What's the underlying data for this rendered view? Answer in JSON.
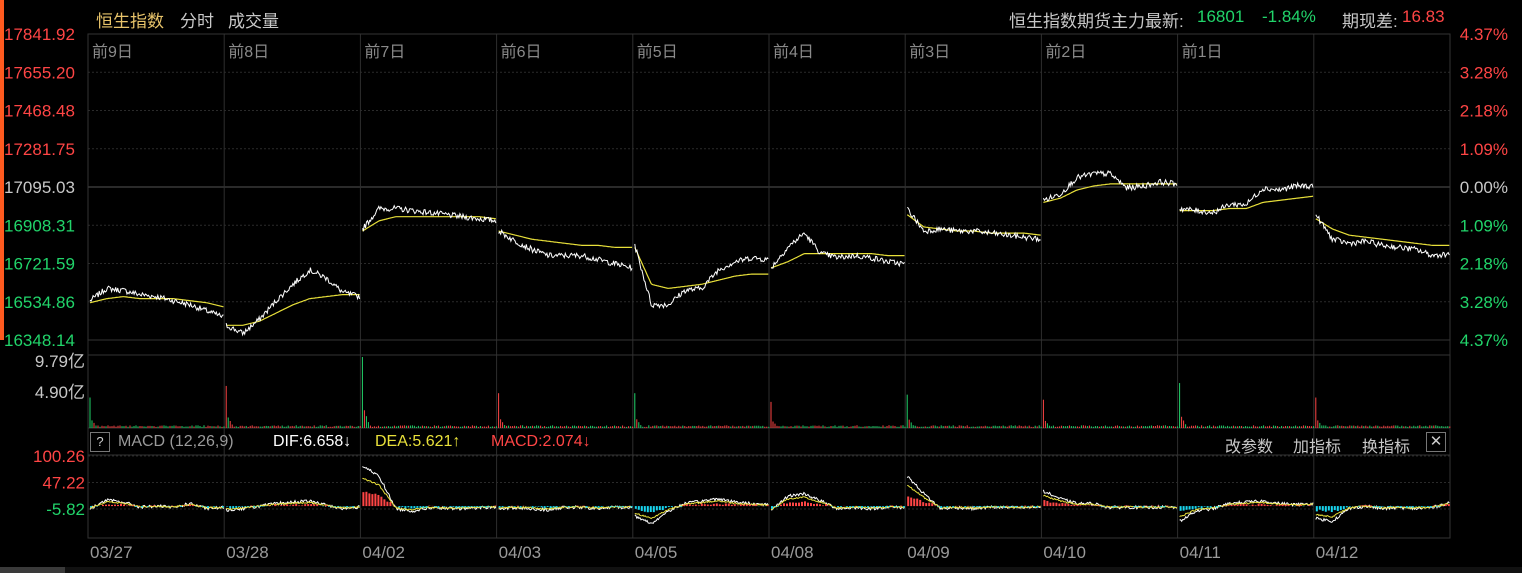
{
  "header": {
    "index_name": "恒生指数",
    "tab_intraday": "分时",
    "tab_volume": "成交量",
    "futures_label": "恒生指数期货主力最新:",
    "futures_price": "16801",
    "futures_change": "-1.84%",
    "basis_label": "期现差:",
    "basis_value": "16.83"
  },
  "macd_panel": {
    "help": "?",
    "title": "MACD (12,26,9)",
    "dif": "DIF:6.658↓",
    "dea": "DEA:5.621↑",
    "macd": "MACD:2.074↓",
    "btn_params": "改参数",
    "btn_add": "加指标",
    "btn_switch": "换指标",
    "close": "✕"
  },
  "colors": {
    "background": "#000000",
    "grid": "#2a2a2a",
    "up": "#ff4545",
    "down": "#21d46a",
    "price_line": "#ffffff",
    "avg_line": "#e8e03a",
    "dea_line": "#e8e03a",
    "macd_down_bar": "#18d6f0",
    "gold_text": "#e7c36a"
  },
  "chart_data": {
    "type": "line",
    "title": "恒生指数",
    "prev_close": 17095.03,
    "price_ticks": [
      "17841.92",
      "17655.20",
      "17468.48",
      "17281.75",
      "17095.03",
      "16908.31",
      "16721.59",
      "16534.86",
      "16348.14"
    ],
    "pct_ticks": [
      "4.37%",
      "3.28%",
      "2.18%",
      "1.09%",
      "0.00%",
      "1.09%",
      "2.18%",
      "3.28%",
      "4.37%"
    ],
    "ylim": [
      16348.14,
      17841.92
    ],
    "day_labels": [
      "前9日",
      "前8日",
      "前7日",
      "前6日",
      "前5日",
      "前4日",
      "前3日",
      "前2日",
      "前1日",
      ""
    ],
    "dates": [
      "03/27",
      "03/28",
      "04/02",
      "04/03",
      "04/05",
      "04/08",
      "04/09",
      "04/10",
      "04/11",
      "04/12"
    ],
    "volume_ticks": [
      "9.79亿",
      "4.90亿"
    ],
    "volume_max": 9.79,
    "macd_ticks": [
      "100.26",
      "47.22",
      "-5.82"
    ],
    "series": [
      {
        "name": "price",
        "days": [
          [
            16540,
            16600,
            16590,
            16570,
            16560,
            16540,
            16520,
            16490,
            16460
          ],
          [
            16420,
            16380,
            16450,
            16540,
            16620,
            16690,
            16650,
            16580,
            16560
          ],
          [
            16890,
            16990,
            16990,
            16980,
            16970,
            16960,
            16950,
            16940,
            16930
          ],
          [
            16880,
            16830,
            16790,
            16760,
            16760,
            16760,
            16740,
            16720,
            16700
          ],
          [
            16810,
            16520,
            16520,
            16590,
            16600,
            16690,
            16730,
            16750,
            16740
          ],
          [
            16700,
            16800,
            16870,
            16770,
            16750,
            16760,
            16750,
            16730,
            16720
          ],
          [
            16990,
            16880,
            16890,
            16880,
            16880,
            16870,
            16860,
            16850,
            16840
          ],
          [
            17030,
            17060,
            17140,
            17160,
            17160,
            17090,
            17100,
            17120,
            17110
          ],
          [
            16990,
            16980,
            16970,
            17010,
            17010,
            17090,
            17080,
            17100,
            17100
          ],
          [
            16960,
            16840,
            16820,
            16830,
            16810,
            16800,
            16790,
            16760,
            16770
          ]
        ]
      },
      {
        "name": "average",
        "days": [
          [
            16530,
            16550,
            16560,
            16550,
            16550,
            16550,
            16540,
            16530,
            16510
          ],
          [
            16420,
            16420,
            16440,
            16480,
            16520,
            16550,
            16560,
            16570,
            16570
          ],
          [
            16880,
            16930,
            16950,
            16950,
            16950,
            16950,
            16950,
            16950,
            16940
          ],
          [
            16880,
            16860,
            16840,
            16830,
            16820,
            16810,
            16810,
            16800,
            16800
          ],
          [
            16800,
            16620,
            16600,
            16610,
            16620,
            16640,
            16660,
            16670,
            16670
          ],
          [
            16700,
            16730,
            16770,
            16770,
            16770,
            16770,
            16770,
            16760,
            16760
          ],
          [
            16960,
            16900,
            16890,
            16880,
            16880,
            16870,
            16870,
            16870,
            16860
          ],
          [
            17020,
            17040,
            17080,
            17100,
            17110,
            17110,
            17110,
            17110,
            17110
          ],
          [
            16980,
            16980,
            16980,
            16990,
            16990,
            17020,
            17030,
            17040,
            17050
          ],
          [
            16940,
            16890,
            16860,
            16850,
            16840,
            16830,
            16820,
            16810,
            16810
          ]
        ]
      },
      {
        "name": "volume",
        "spikes": [
          4.2,
          5.8,
          9.79,
          4.8,
          4.8,
          3.6,
          4.6,
          3.9,
          6.2,
          4.2
        ]
      },
      {
        "name": "dif",
        "days": [
          [
            -5,
            12,
            8,
            -2,
            0,
            -3,
            5,
            -5,
            -3
          ],
          [
            -8,
            -5,
            0,
            5,
            8,
            10,
            2,
            -5,
            -2
          ],
          [
            80,
            60,
            -5,
            -10,
            -3,
            -5,
            -5,
            -3,
            -2
          ],
          [
            -5,
            -3,
            -5,
            -8,
            -2,
            -3,
            -5,
            -2,
            -3
          ],
          [
            -20,
            -35,
            -10,
            5,
            10,
            15,
            8,
            5,
            3
          ],
          [
            -10,
            20,
            25,
            10,
            -5,
            -3,
            -5,
            -2,
            -3
          ],
          [
            60,
            25,
            -5,
            -3,
            -5,
            -2,
            -3,
            -3,
            -2
          ],
          [
            30,
            15,
            5,
            5,
            -3,
            -2,
            -3,
            -2,
            -3
          ],
          [
            -30,
            -10,
            -5,
            5,
            8,
            10,
            5,
            3,
            5
          ],
          [
            -25,
            -30,
            -5,
            0,
            -5,
            -3,
            -5,
            -3,
            7
          ]
        ]
      }
    ]
  }
}
